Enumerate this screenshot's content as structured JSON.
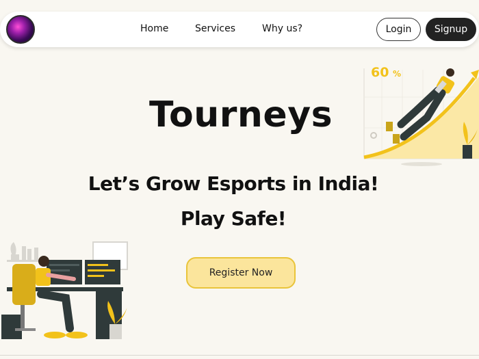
{
  "nav": {
    "links": [
      "Home",
      "Services",
      "Why us?"
    ],
    "login_label": "Login",
    "signup_label": "Signup"
  },
  "hero": {
    "title": "Tourneys",
    "tagline_1": "Let’s Grow Esports in India!",
    "tagline_2": "Play Safe!",
    "register_label": "Register Now"
  },
  "illustration": {
    "growth_percent_label": "60",
    "growth_percent_sign": "%"
  },
  "colors": {
    "accent_yellow": "#f2c21b",
    "button_fill": "#fbe59c",
    "button_border": "#e9c43a",
    "dark": "#222222",
    "background": "#f9f7f1"
  },
  "icons": [
    "site-logo-icon",
    "growth-chart-illustration-icon",
    "gamer-desk-illustration-icon"
  ]
}
